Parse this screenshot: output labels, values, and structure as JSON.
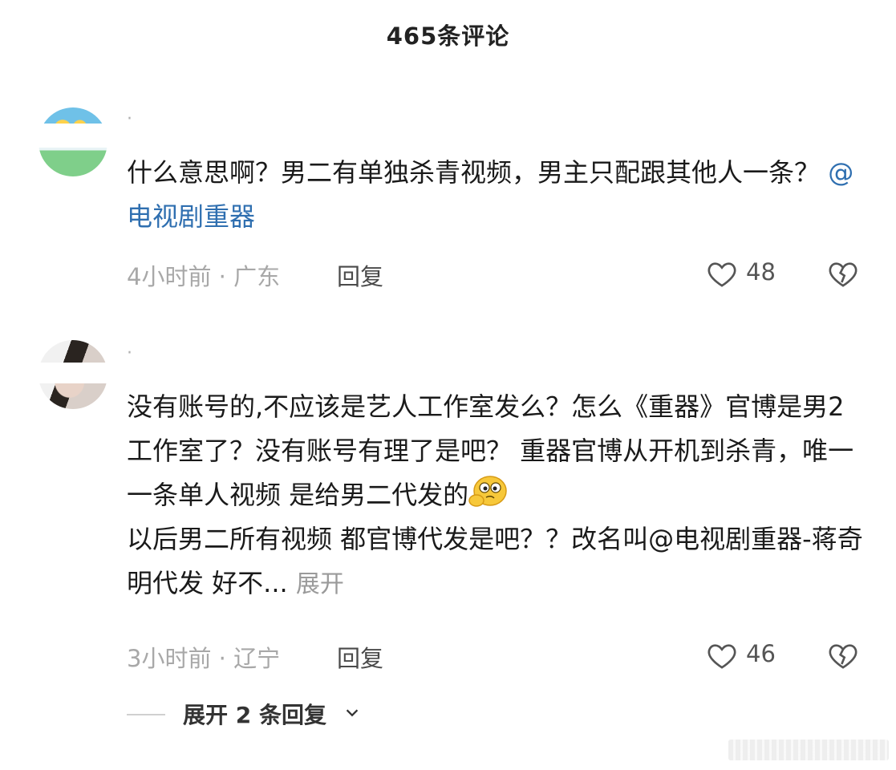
{
  "header": {
    "title": "465条评论"
  },
  "comments": [
    {
      "text": "什么意思啊？男二有单独杀青视频，男主只配跟其他人一条？",
      "mention": "@电视剧重器",
      "time_location": "4小时前 · 广东",
      "reply_label": "回复",
      "like_count": "48",
      "expand_inline": ""
    },
    {
      "text_part1": "没有账号的,不应该是艺人工作室发么？怎么《重器》官博是男2工作室了？没有账号有理了是吧？ 重器官博从开机到杀青，唯一一条单人视频 是给男二代发的",
      "text_part2": "以后男二所有视频 都官博代发是吧？？改名叫@电视剧重器-蒋奇明代发  好不...",
      "expand_inline": "展开",
      "time_location": "3小时前 · 辽宁",
      "reply_label": "回复",
      "like_count": "46"
    }
  ],
  "replies": {
    "expand_label": "展开 2 条回复"
  },
  "icons": {
    "like": "heart-outline-icon",
    "dislike": "broken-heart-icon",
    "chevron": "chevron-down-icon",
    "emoji": "thinking-face-emoji-icon"
  },
  "colors": {
    "mention": "#2f6fb0",
    "muted": "#a8a8a8",
    "text": "#1a1a1a"
  }
}
